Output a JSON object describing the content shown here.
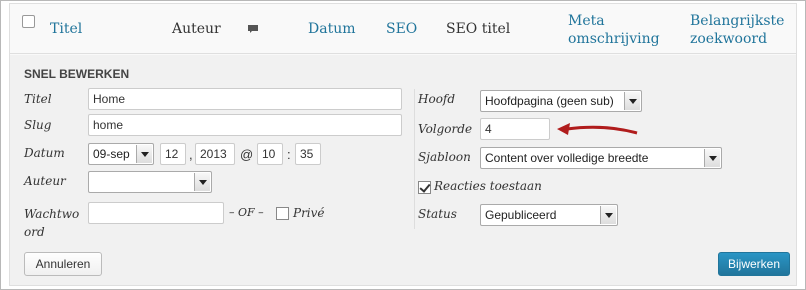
{
  "header": {
    "col_title": "Titel",
    "col_author": "Auteur",
    "col_comments_icon": "comment-icon",
    "col_date": "Datum",
    "col_seo": "SEO",
    "col_seo_title": "SEO titel",
    "col_meta_line1": "Meta",
    "col_meta_line2": "omschrijving",
    "col_keyword_line1": "Belangrijkste",
    "col_keyword_line2": "zoekwoord"
  },
  "quick_edit": {
    "heading": "SNEL BEWERKEN",
    "title_label": "Titel",
    "title_value": "Home",
    "slug_label": "Slug",
    "slug_value": "home",
    "date_label": "Datum",
    "date_month": "09-sep",
    "date_day": "12",
    "date_sep_comma": ",",
    "date_year": "2013",
    "date_at": "@",
    "date_hour": "10",
    "date_colon": ":",
    "date_minute": "35",
    "author_label": "Auteur",
    "author_value": "",
    "password_label_line1": "Wachtwo",
    "password_label_line2": "ord",
    "password_value": "",
    "or_text": "– OF –",
    "private_label": "Privé",
    "parent_label": "Hoofd",
    "parent_value": "Hoofdpagina (geen sub)",
    "order_label": "Volgorde",
    "order_value": "4",
    "template_label": "Sjabloon",
    "template_value": "Content over volledige breedte",
    "comments_label": "Reacties toestaan",
    "comments_checked": true,
    "status_label": "Status",
    "status_value": "Gepubliceerd",
    "cancel_label": "Annuleren",
    "update_label": "Bijwerken"
  },
  "colors": {
    "link": "#21759b",
    "annotation_arrow": "#b01c1c",
    "primary_button": "#21759b"
  }
}
